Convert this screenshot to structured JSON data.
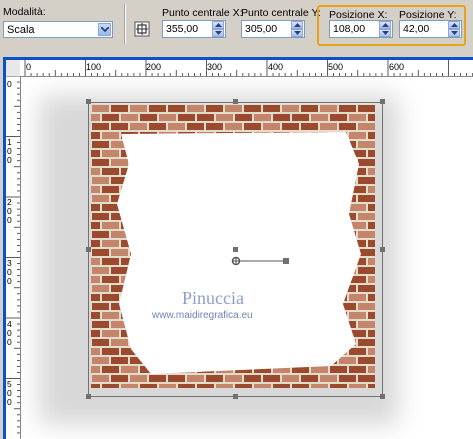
{
  "toolbar": {
    "mode_label": "Modalità:",
    "mode_value": "Scala",
    "center_x_label": "Punto centrale X:",
    "center_x_value": "355,00",
    "center_y_label": "Punto centrale Y:",
    "center_y_value": "305,00",
    "pos_x_label": "Posizione X:",
    "pos_x_value": "108,00",
    "pos_y_label": "Posizione Y:",
    "pos_y_value": "42,00",
    "highlight_color": "#e8a21c"
  },
  "ruler_top": {
    "labels": [
      "0",
      "100",
      "200",
      "300",
      "400",
      "500",
      "600"
    ]
  },
  "ruler_left": {
    "labels": [
      "0",
      "100",
      "200",
      "300",
      "400",
      "500"
    ]
  },
  "canvas": {
    "watermark_name": "Pinuccia",
    "watermark_url": "www.maidiregrafica.eu"
  },
  "colors": {
    "window_frame": "#0a52c8",
    "brick": "#9c4a2e",
    "brick_light": "#c4856a",
    "mortar": "#e2dccd"
  }
}
